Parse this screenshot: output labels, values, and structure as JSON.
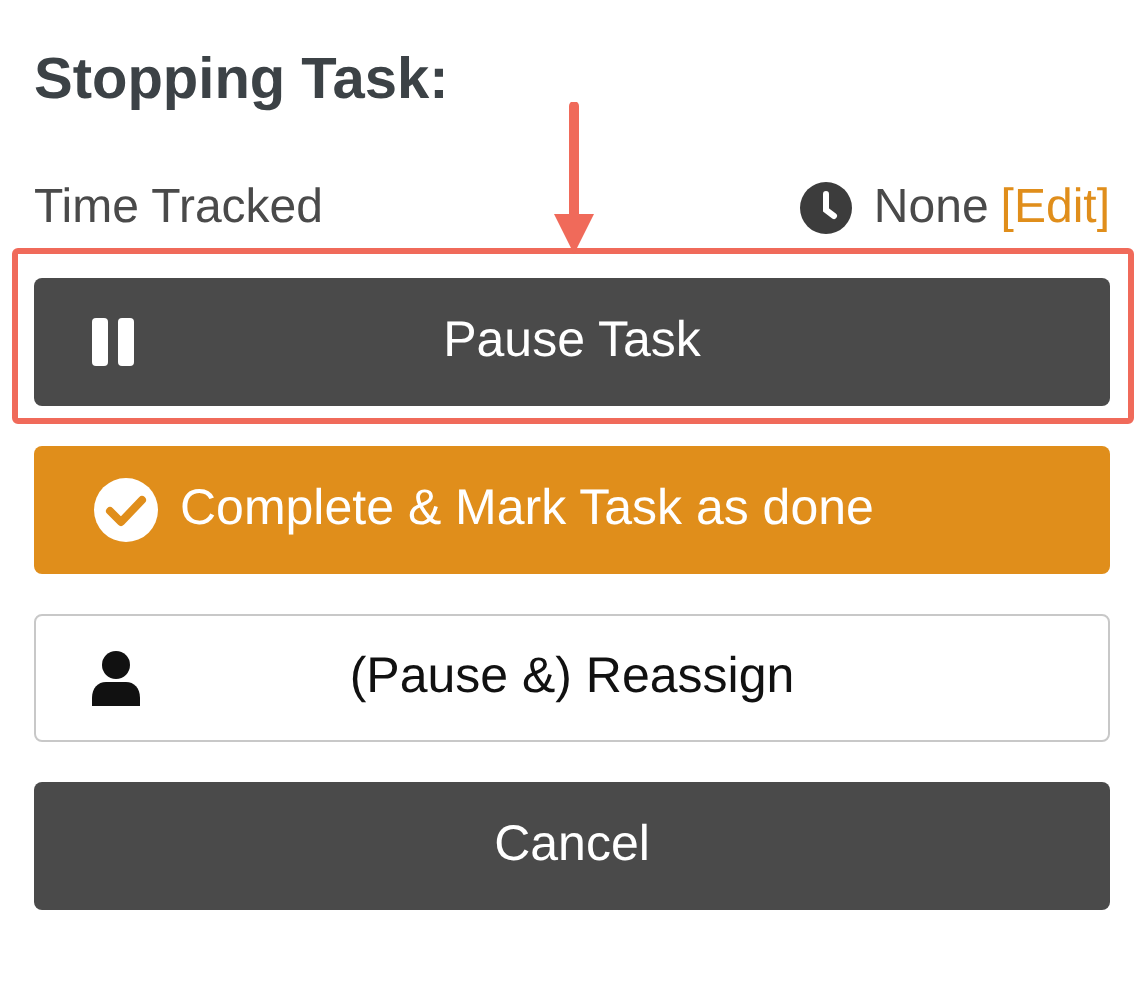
{
  "title": "Stopping Task:",
  "time_tracked": {
    "label": "Time Tracked",
    "value": "None",
    "edit_link": "[Edit]"
  },
  "buttons": [
    {
      "kind": "pause",
      "label": "Pause Task",
      "highlighted": true
    },
    {
      "kind": "complete",
      "label": "Complete & Mark Task as done",
      "highlighted": false
    },
    {
      "kind": "reassign",
      "label": "(Pause &) Reassign",
      "highlighted": false
    },
    {
      "kind": "cancel",
      "label": "Cancel",
      "highlighted": false
    }
  ]
}
